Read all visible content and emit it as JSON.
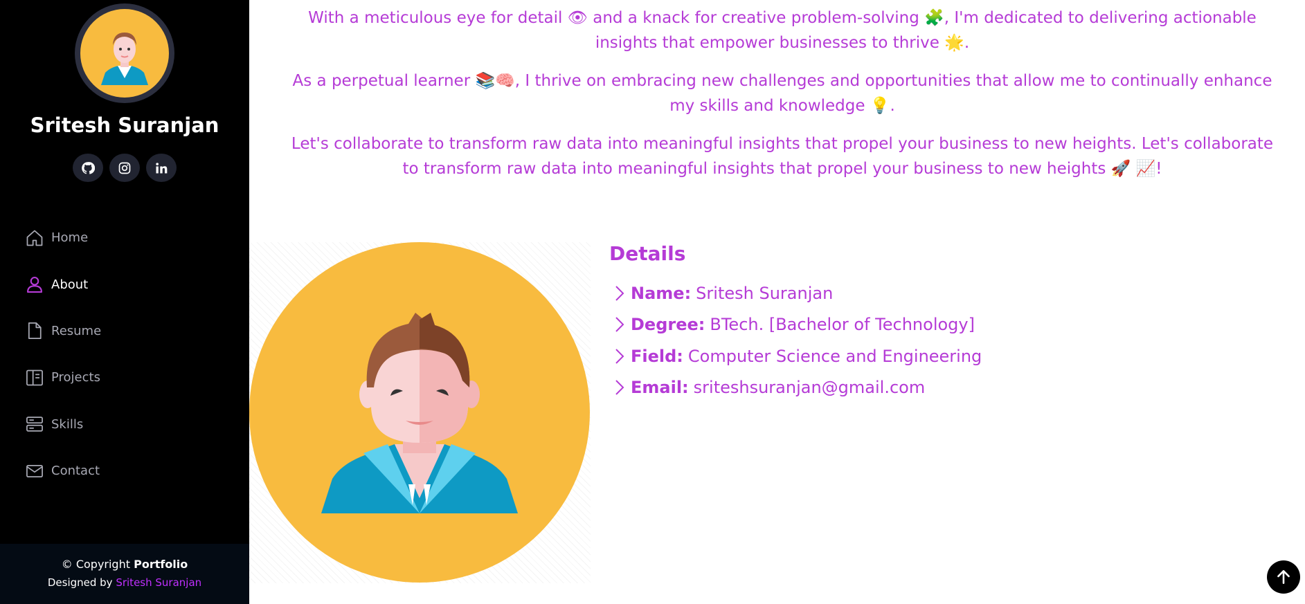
{
  "profile": {
    "name": "Sritesh Suranjan"
  },
  "social": [
    {
      "icon": "github-icon"
    },
    {
      "icon": "instagram-icon"
    },
    {
      "icon": "linkedin-icon"
    }
  ],
  "nav": {
    "items": [
      {
        "label": "Home",
        "icon": "home-icon",
        "active": false
      },
      {
        "label": "About",
        "icon": "person-icon",
        "active": true
      },
      {
        "label": "Resume",
        "icon": "file-icon",
        "active": false
      },
      {
        "label": "Projects",
        "icon": "book-icon",
        "active": false
      },
      {
        "label": "Skills",
        "icon": "server-icon",
        "active": false
      },
      {
        "label": "Contact",
        "icon": "envelope-icon",
        "active": false
      }
    ]
  },
  "footer": {
    "copyright_prefix": "© Copyright ",
    "copyright_brand": "Portfolio",
    "designed_prefix": "Designed by ",
    "designed_name": "Sritesh Suranjan"
  },
  "intro": {
    "p1": "With a meticulous eye for detail 👁 and a knack for creative problem-solving 🧩, I'm dedicated to delivering actionable insights that empower businesses to thrive 🌟.",
    "p2": "As a perpetual learner 📚🧠, I thrive on embracing new challenges and opportunities that allow me to continually enhance my skills and knowledge 💡.",
    "p3": "Let's collaborate to transform raw data into meaningful insights that propel your business to new heights. Let's collaborate to transform raw data into meaningful insights that propel your business to new heights 🚀 📈!"
  },
  "details": {
    "title": "Details",
    "rows": [
      {
        "label": "Name:",
        "value": "Sritesh Suranjan"
      },
      {
        "label": "Degree:",
        "value": "BTech. [Bachelor of Technology]"
      },
      {
        "label": "Field:",
        "value": "Computer Science and Engineering"
      },
      {
        "label": "Email:",
        "value": "sriteshsuranjan@gmail.com"
      }
    ]
  },
  "colors": {
    "accent": "#b53bd6",
    "link": "#c030ff",
    "sidebar_bg": "#000000",
    "avatar_bg": "#f8bb3f"
  }
}
